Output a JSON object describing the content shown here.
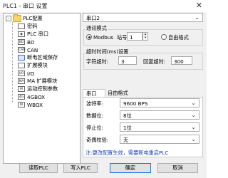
{
  "window": {
    "title": "PLC1 - 串口 设置",
    "close_glyph": "✕"
  },
  "tree": {
    "root_label": "PLC配置",
    "expander": "-",
    "items": [
      {
        "label": "密码",
        "icon": "key-icon",
        "icon_text": ""
      },
      {
        "label": "PLC 串口",
        "icon": "serial-port-icon",
        "icon_text": "◉"
      },
      {
        "label": "BD",
        "icon": "bd-board-icon",
        "icon_text": "BD"
      },
      {
        "label": "CAN",
        "icon": "can-icon",
        "icon_text": "CAN"
      },
      {
        "label": "断电区域保存",
        "icon": "power-save-icon",
        "icon_text": ""
      },
      {
        "label": "扩展模块",
        "icon": "module-icon",
        "icon_text": ""
      },
      {
        "label": "I/O",
        "icon": "io-icon",
        "icon_text": "I/O"
      },
      {
        "label": "MA 扩展模块",
        "icon": "ma-module-icon",
        "icon_text": "MA"
      },
      {
        "label": "运动控制参数",
        "icon": "motion-control-icon",
        "icon_text": "M"
      },
      {
        "label": "4GBOX",
        "icon": "4gbox-icon",
        "icon_text": "4G"
      },
      {
        "label": "WBOX",
        "icon": "wbox-icon",
        "icon_text": "W"
      }
    ]
  },
  "port_select": {
    "value": "串口2"
  },
  "comm_mode": {
    "group_label": "通讯模式",
    "modbus_label": "Modbus",
    "station_label": "站号",
    "station_value": "1",
    "free_format_label": "自由格式"
  },
  "timeout": {
    "group_label": "超时时间(ms)设置",
    "char_timeout_label": "字符超时:",
    "char_timeout_value": "3",
    "reply_timeout_label": "回复超时:",
    "reply_timeout_value": "300"
  },
  "tabs": [
    {
      "label": "串口"
    },
    {
      "label": "自由格式"
    }
  ],
  "serial": {
    "baud_label": "波特率:",
    "baud_value": "9600 BPS",
    "data_label": "数据位:",
    "data_value": "8位",
    "stop_label": "停止位:",
    "stop_value": "1位",
    "parity_label": "奇偶校验:",
    "parity_value": "无",
    "dropdown_glyph": "⌄"
  },
  "note": "注:更改配置生效，需要断电重启PLC",
  "buttons": {
    "read": "读取PLC",
    "write": "写入PLC",
    "ok": "确定",
    "cancel": "取消"
  },
  "colors": {
    "note": "#1a3fbd",
    "default_button_border": "#1a73e8"
  }
}
